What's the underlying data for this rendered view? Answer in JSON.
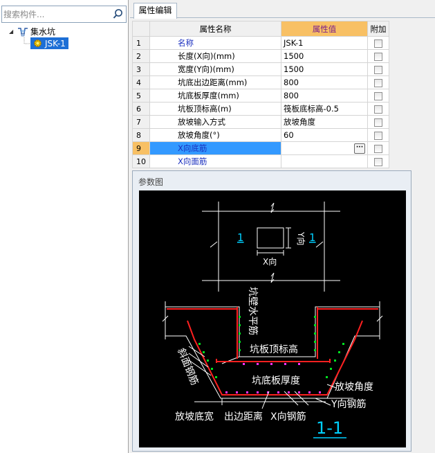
{
  "search": {
    "placeholder": "搜索构件..."
  },
  "tree": {
    "root": {
      "label": "集水坑",
      "toggle": "◢"
    },
    "child": {
      "label": "JSK-1"
    }
  },
  "tabs": [
    {
      "label": "属性编辑"
    }
  ],
  "grid": {
    "headers": {
      "name": "属性名称",
      "value": "属性值",
      "extra": "附加"
    },
    "rows": [
      {
        "num": "1",
        "name": "名称",
        "value": "JSK-1"
      },
      {
        "num": "2",
        "name": "长度(X向)(mm)",
        "value": "1500"
      },
      {
        "num": "3",
        "name": "宽度(Y向)(mm)",
        "value": "1500"
      },
      {
        "num": "4",
        "name": "坑底出边距离(mm)",
        "value": "800"
      },
      {
        "num": "5",
        "name": "坑底板厚度(mm)",
        "value": "800"
      },
      {
        "num": "6",
        "name": "坑板顶标高(m)",
        "value": "筏板底标高-0.5"
      },
      {
        "num": "7",
        "name": "放坡输入方式",
        "value": "放坡角度"
      },
      {
        "num": "8",
        "name": "放坡角度(°)",
        "value": "60"
      },
      {
        "num": "9",
        "name": "X向底筋",
        "value": "",
        "button": "···"
      },
      {
        "num": "10",
        "name": "X向面筋",
        "value": ""
      }
    ]
  },
  "param_panel": {
    "title": "参数图",
    "diagram": {
      "plan_section_left": "1",
      "plan_section_right": "1",
      "plan_x_dim": "X向",
      "plan_y_dim": "Y向",
      "wall_rebar": "坑壁水平筋",
      "top_elevation": "坑板顶标高",
      "slope_rebar": "斜面钢筋",
      "bottom_thickness": "坑底板厚度",
      "slope_angle": "放坡角度",
      "y_rebar": "Y向钢筋",
      "slope_bottom_width": "放坡底宽",
      "edge_distance": "出边距离",
      "x_rebar": "X向钢筋",
      "section_title": "1-1"
    }
  },
  "colors": {
    "selection_blue": "#3399ff",
    "header_orange": "#f8c064",
    "link_blue": "#1a2fbf",
    "rebar_red": "#ff2020",
    "rebar_green": "#00e020",
    "stirrup_magenta": "#ff30ff",
    "dim_cyan": "#00d0ff"
  },
  "icons": {
    "search": "search-icon",
    "pit": "pit-icon",
    "component": "component-icon",
    "checkbox": "checkbox"
  }
}
